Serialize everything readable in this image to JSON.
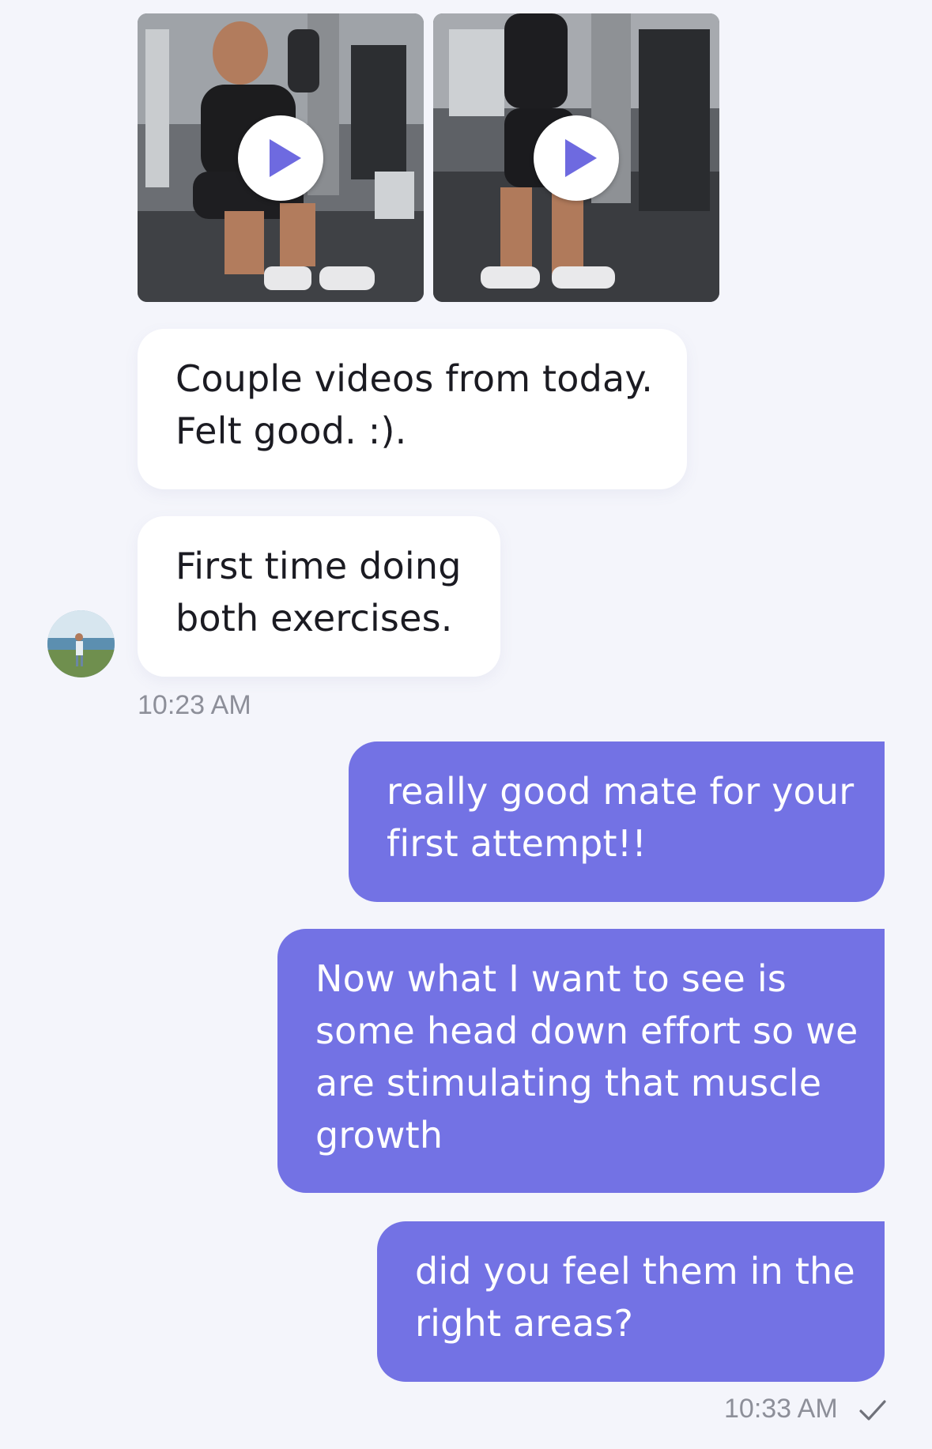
{
  "thread": {
    "videos": [
      {
        "icon": "play-icon"
      },
      {
        "icon": "play-icon"
      }
    ],
    "incoming": [
      {
        "lines": [
          "Couple videos from today.",
          "Felt good. :)."
        ]
      },
      {
        "lines": [
          "First time doing",
          "both exercises."
        ]
      }
    ],
    "incoming_time": "10:23 AM",
    "outgoing": [
      {
        "lines": [
          "really good mate for your",
          "first attempt!!"
        ]
      },
      {
        "lines": [
          "Now what I want to see is",
          "some head down effort so we",
          "are stimulating that muscle",
          "growth"
        ]
      },
      {
        "lines": [
          "did you feel them in the",
          "right areas?"
        ]
      }
    ],
    "outgoing_time": "10:33 AM",
    "status_icon": "checkmark-icon"
  },
  "colors": {
    "background": "#f4f5fb",
    "outgoing_bubble": "#7372e4",
    "incoming_bubble": "#ffffff",
    "play_accent": "#6e6ae0",
    "timestamp": "#8d8f99"
  }
}
